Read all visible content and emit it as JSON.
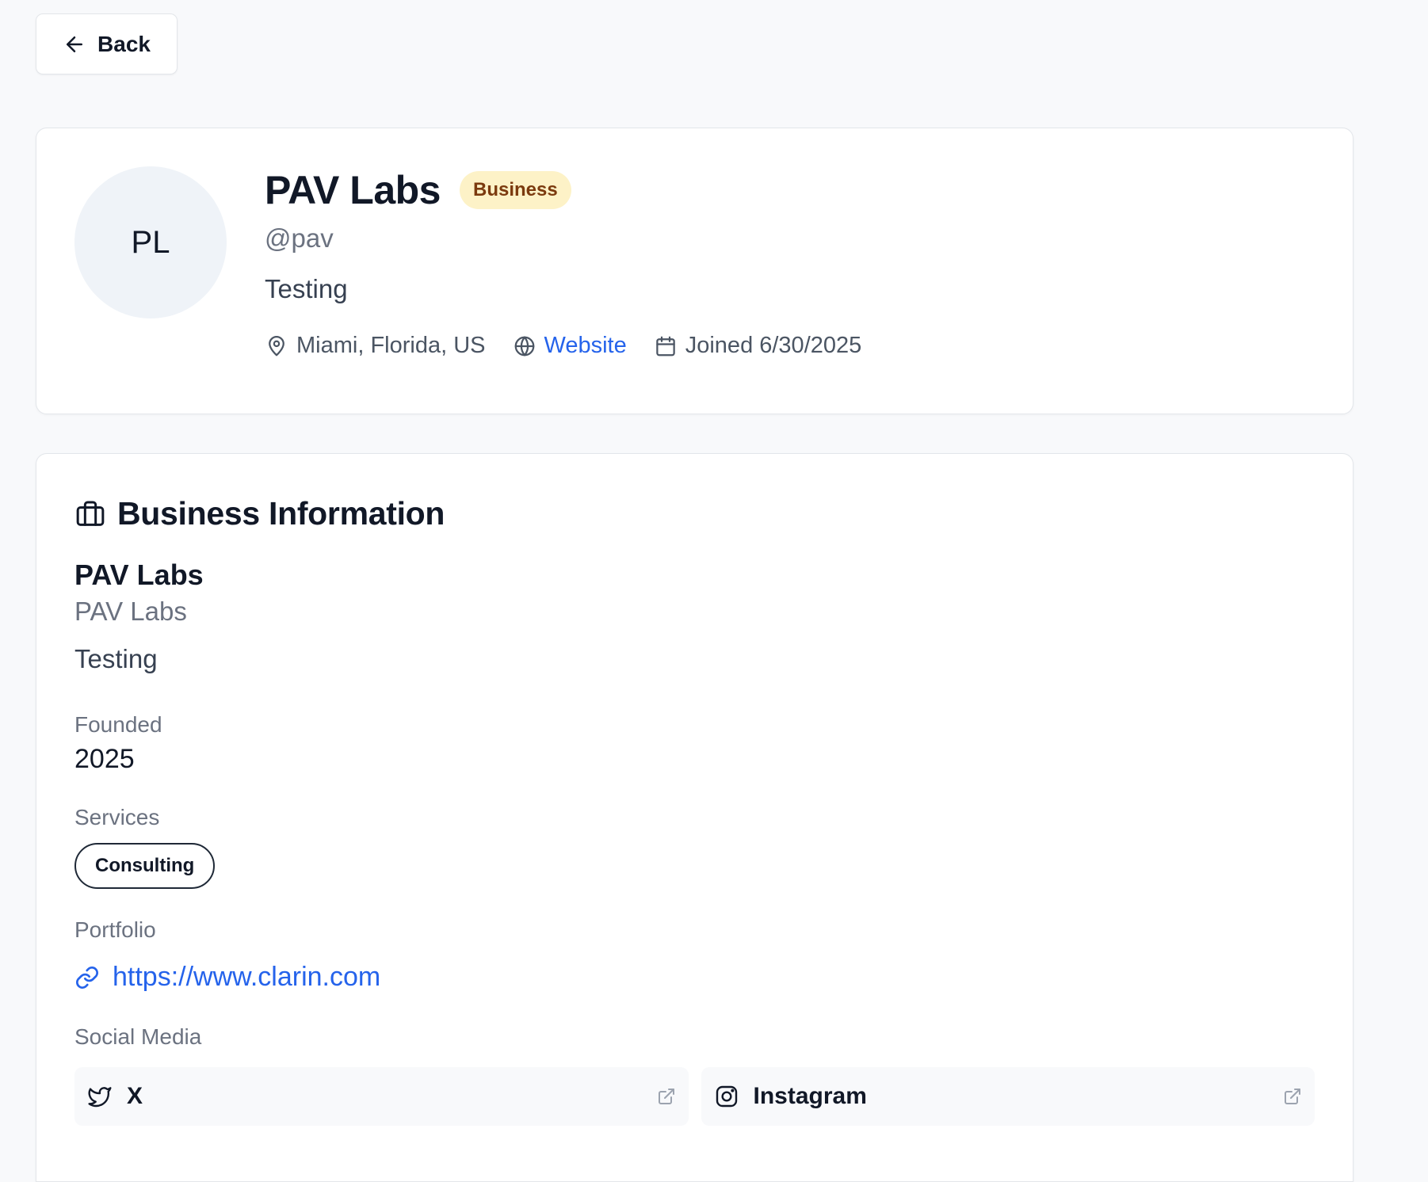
{
  "nav": {
    "back_label": "Back"
  },
  "profile": {
    "initials": "PL",
    "name": "PAV Labs",
    "badge": "Business",
    "handle": "@pav",
    "bio": "Testing",
    "location": "Miami, Florida, US",
    "website_label": "Website",
    "joined": "Joined 6/30/2025"
  },
  "business": {
    "section_title": "Business Information",
    "name": "PAV Labs",
    "legal_name": "PAV Labs",
    "description": "Testing",
    "founded_label": "Founded",
    "founded_value": "2025",
    "services_label": "Services",
    "services": [
      "Consulting"
    ],
    "portfolio_label": "Portfolio",
    "portfolio_url": "https://www.clarin.com",
    "social_label": "Social Media",
    "social": [
      {
        "name": "X",
        "icon": "twitter-icon"
      },
      {
        "name": "Instagram",
        "icon": "instagram-icon"
      }
    ]
  },
  "colors": {
    "background": "#f8f9fb",
    "badge_bg": "#fdf2c7",
    "badge_text": "#7b3a0e",
    "link": "#2563eb",
    "avatar_bg": "#eff3f8"
  }
}
